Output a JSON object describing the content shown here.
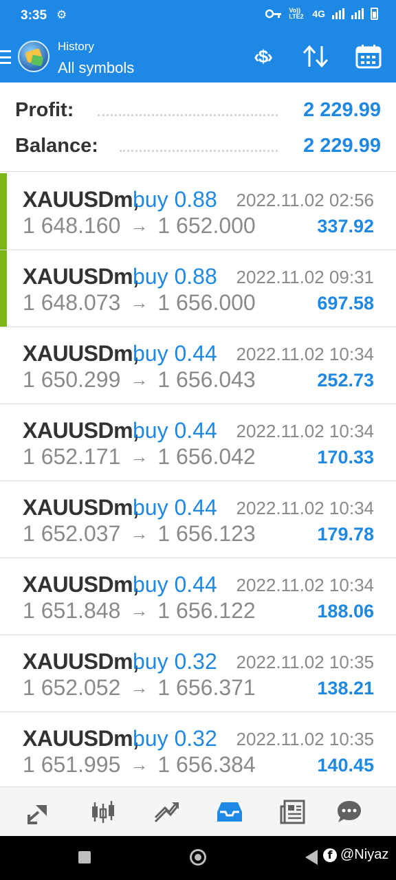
{
  "status_bar": {
    "time": "3:35",
    "network_label": "4G",
    "volte_label": "Vo)) LTE2"
  },
  "app_bar": {
    "section": "History",
    "filter": "All symbols"
  },
  "summary": {
    "profit_label": "Profit:",
    "profit_value": "2 229.99",
    "balance_label": "Balance:",
    "balance_value": "2 229.99"
  },
  "deals": [
    {
      "symbol": "XAUUSDm,",
      "type": "buy 0.88",
      "time": "2022.11.02 02:56",
      "open": "1 648.160",
      "close": "1 652.000",
      "profit": "337.92",
      "accent": true
    },
    {
      "symbol": "XAUUSDm,",
      "type": "buy 0.88",
      "time": "2022.11.02 09:31",
      "open": "1 648.073",
      "close": "1 656.000",
      "profit": "697.58",
      "accent": true
    },
    {
      "symbol": "XAUUSDm,",
      "type": "buy 0.44",
      "time": "2022.11.02 10:34",
      "open": "1 650.299",
      "close": "1 656.043",
      "profit": "252.73",
      "accent": false
    },
    {
      "symbol": "XAUUSDm,",
      "type": "buy 0.44",
      "time": "2022.11.02 10:34",
      "open": "1 652.171",
      "close": "1 656.042",
      "profit": "170.33",
      "accent": false
    },
    {
      "symbol": "XAUUSDm,",
      "type": "buy 0.44",
      "time": "2022.11.02 10:34",
      "open": "1 652.037",
      "close": "1 656.123",
      "profit": "179.78",
      "accent": false
    },
    {
      "symbol": "XAUUSDm,",
      "type": "buy 0.44",
      "time": "2022.11.02 10:34",
      "open": "1 651.848",
      "close": "1 656.122",
      "profit": "188.06",
      "accent": false
    },
    {
      "symbol": "XAUUSDm,",
      "type": "buy 0.32",
      "time": "2022.11.02 10:35",
      "open": "1 652.052",
      "close": "1 656.371",
      "profit": "138.21",
      "accent": false
    },
    {
      "symbol": "XAUUSDm,",
      "type": "buy 0.32",
      "time": "2022.11.02 10:35",
      "open": "1 651.995",
      "close": "1 656.384",
      "profit": "140.45",
      "accent": false
    }
  ],
  "arrow_glyph": "→",
  "colors": {
    "accent_blue": "#1e88e5",
    "profit_bar_green": "#7cb518",
    "muted_gray": "#8a8a8a",
    "nav_gray": "#616161"
  },
  "bottom_nav": [
    {
      "icon": "quotes-icon",
      "active": false
    },
    {
      "icon": "chart-icon",
      "active": false
    },
    {
      "icon": "trade-icon",
      "active": false
    },
    {
      "icon": "history-icon",
      "active": true
    },
    {
      "icon": "news-icon",
      "active": false
    },
    {
      "icon": "messages-icon",
      "active": false
    }
  ],
  "watermark": "@Niyaz"
}
